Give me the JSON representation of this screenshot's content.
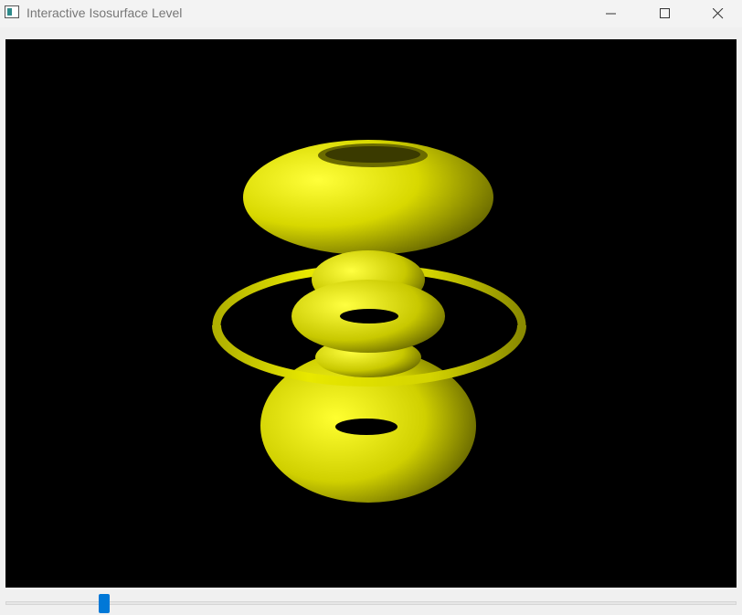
{
  "window": {
    "title": "Interactive Isosurface Level",
    "icon": "app-window-icon",
    "controls": {
      "minimize": "minimize-icon",
      "maximize": "maximize-icon",
      "close": "close-icon"
    }
  },
  "viewport": {
    "background": "#000000",
    "surface_color": "#ffff00",
    "content": "isosurface-render"
  },
  "slider": {
    "value_fraction": 0.13,
    "accent": "#0078d7"
  }
}
